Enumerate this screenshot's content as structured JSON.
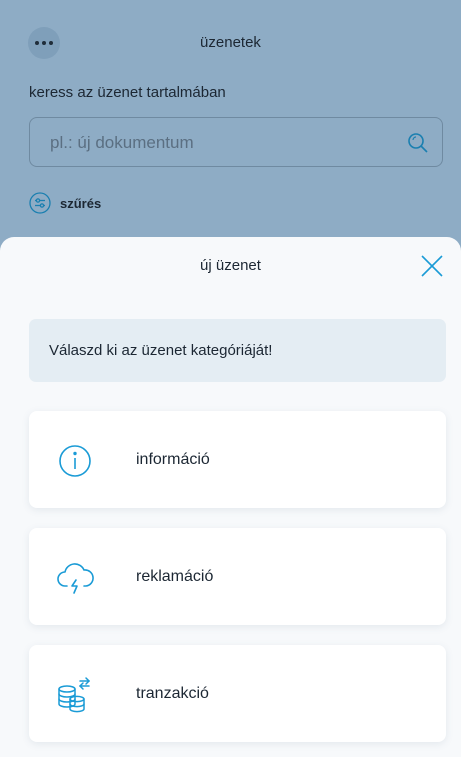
{
  "background": {
    "title": "üzenetek",
    "more_icon": "more-dots-icon",
    "search_label": "keress az üzenet tartalmában",
    "search_placeholder": "pl.: új dokumentum",
    "search_value": "",
    "search_icon": "search-icon",
    "filter_label": "szűrés",
    "filter_icon": "filter-icon"
  },
  "sheet": {
    "title": "új üzenet",
    "close_icon": "close-icon",
    "instruction": "Válaszd ki az üzenet kategóriáját!",
    "categories": [
      {
        "label": "információ",
        "icon": "info-icon"
      },
      {
        "label": "reklamáció",
        "icon": "cloud-lightning-icon"
      },
      {
        "label": "tranzakció",
        "icon": "coins-transfer-icon"
      }
    ]
  },
  "colors": {
    "accent": "#1a9bd6",
    "overlay_bg": "#8eacc5",
    "sheet_bg": "#f7f9fb",
    "instruction_bg": "#e4edf3",
    "text": "#1c2733"
  }
}
